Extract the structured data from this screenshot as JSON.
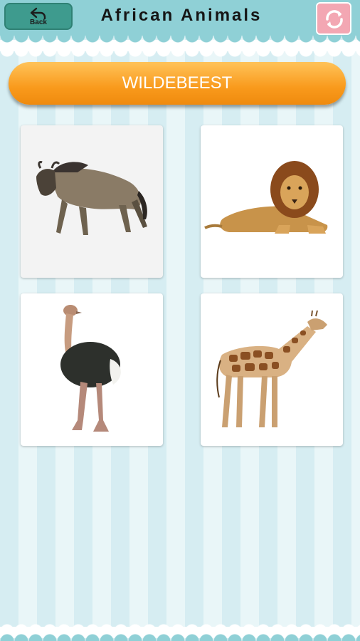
{
  "header": {
    "back_label": "Back",
    "title": "African Animals"
  },
  "answer": {
    "text": "WILDEBEEST"
  },
  "cards": [
    {
      "animal": "wildebeest"
    },
    {
      "animal": "lion"
    },
    {
      "animal": "ostrich"
    },
    {
      "animal": "giraffe"
    }
  ],
  "colors": {
    "header": "#8fd0d6",
    "back_button": "#3e9b8e",
    "refresh_button": "#f3a7b3",
    "answer_bar": "#f99a1c",
    "stripe_dark": "#d6edf2",
    "stripe_light": "#e9f6f8"
  }
}
